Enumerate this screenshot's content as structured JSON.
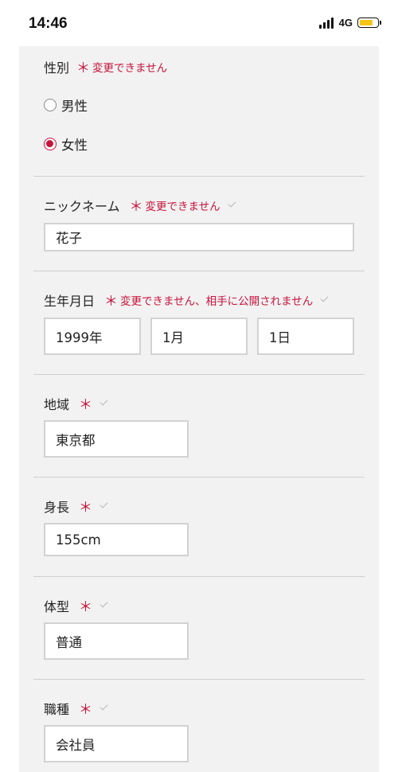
{
  "status_bar": {
    "time": "14:46",
    "network": "4G"
  },
  "colors": {
    "accent": "#c8143c",
    "panel": "#f2f2f2",
    "battery": "#f5c518"
  },
  "gender": {
    "label": "性別",
    "required_mark": "＊",
    "note": "変更できません",
    "options": [
      {
        "label": "男性",
        "checked": false
      },
      {
        "label": "女性",
        "checked": true
      }
    ]
  },
  "nickname": {
    "label": "ニックネーム",
    "required_mark": "＊",
    "note": "変更できません",
    "value": "花子"
  },
  "birthday": {
    "label": "生年月日",
    "required_mark": "＊",
    "note": "変更できません、相手に公開されません",
    "year": "1999年",
    "month": "1月",
    "day": "1日"
  },
  "region": {
    "label": "地域",
    "required_mark": "＊",
    "value": "東京都"
  },
  "height": {
    "label": "身長",
    "required_mark": "＊",
    "value": "155cm"
  },
  "body_type": {
    "label": "体型",
    "required_mark": "＊",
    "value": "普通"
  },
  "occupation": {
    "label": "職種",
    "required_mark": "＊",
    "value": "会社員"
  }
}
